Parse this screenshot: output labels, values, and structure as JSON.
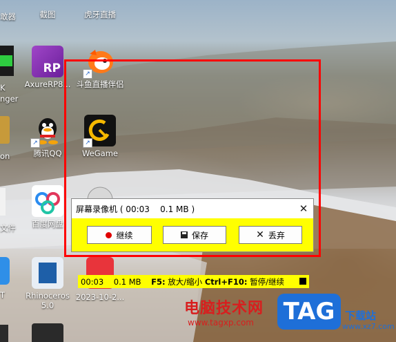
{
  "desktop": {
    "icons": [
      {
        "label": "截图",
        "icon": "screenshot-icon"
      },
      {
        "label": "虎牙直播",
        "icon": "huya-icon"
      },
      {
        "label": "AxureRP8...",
        "icon": "axure-icon",
        "badge": "RP"
      },
      {
        "label": "斗鱼直播伴侣",
        "icon": "douyu-icon"
      },
      {
        "label": "腾讯QQ",
        "icon": "qq-icon"
      },
      {
        "label": "WeGame",
        "icon": "wegame-icon"
      },
      {
        "label": "百度网盘",
        "icon": "baidu-netdisk-icon"
      },
      {
        "label": "Rhinoceros\n5.0",
        "icon": "rhinoceros-icon"
      },
      {
        "label": "2023-10-2...",
        "icon": "pdf-icon"
      }
    ],
    "left_partial": [
      "敢器",
      "K",
      "nger",
      "on",
      "文件",
      "T"
    ]
  },
  "recorder": {
    "title": "屏幕录像机 ( 00:03    0.1 MB )",
    "close_symbol": "✕",
    "buttons": {
      "continue": "继续",
      "save": "保存",
      "discard": "丢弃"
    }
  },
  "status_bar": {
    "time": "00:03",
    "size": "0.1 MB",
    "f5_key": "F5:",
    "f5_action": "放大/缩小",
    "f10_key": "Ctrl+F10:",
    "f10_action": "暂停/继续"
  },
  "watermark": {
    "site_name": "电脑技术网",
    "url": "www.tagxp.com",
    "logo": "TAG",
    "download": "下载站",
    "dl_url": "www.xz7.com"
  },
  "colors": {
    "frame": "#ff0000",
    "yellow": "#ffff00",
    "record_dot": "#e00000",
    "watermark_red": "#d81e1e",
    "tag_blue": "#1e6fd8"
  }
}
